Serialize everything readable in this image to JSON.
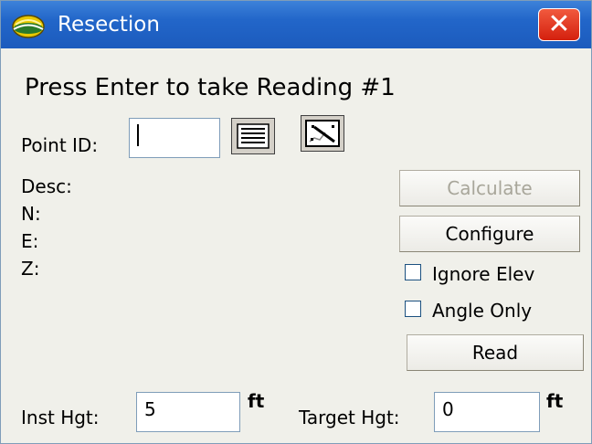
{
  "window": {
    "title": "Resection",
    "close_glyph": "✕"
  },
  "instruction": "Press Enter to take Reading #1",
  "point": {
    "label": "Point ID:",
    "value": ""
  },
  "info": {
    "desc_label": "Desc:",
    "n_label": "N:",
    "e_label": "E:",
    "z_label": "Z:"
  },
  "buttons": {
    "calculate": "Calculate",
    "configure": "Configure",
    "read": "Read"
  },
  "checkboxes": {
    "ignore_elev": {
      "label": "Ignore Elev",
      "checked": false
    },
    "angle_only": {
      "label": "Angle Only",
      "checked": false
    }
  },
  "inst": {
    "label": "Inst Hgt:",
    "value": "5",
    "unit": "ft"
  },
  "target": {
    "label": "Target Hgt:",
    "value": "0",
    "unit": "ft"
  },
  "icons": {
    "app": "hardhat-icon",
    "list": "list-icon",
    "map": "map-icon",
    "close": "close-icon"
  },
  "colors": {
    "titlebar": "#2266c9",
    "close": "#d4200e",
    "background": "#f0f0ea"
  }
}
